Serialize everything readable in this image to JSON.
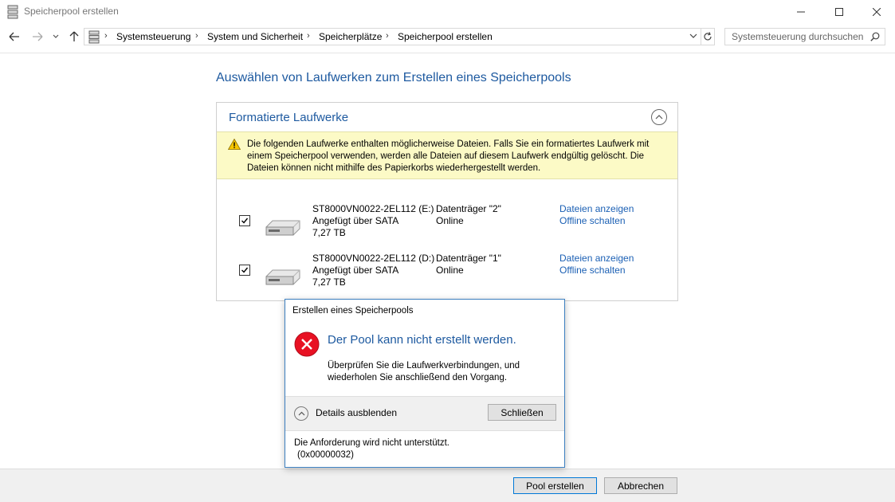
{
  "window": {
    "title": "Speicherpool erstellen"
  },
  "address": {
    "breadcrumbs": [
      "Systemsteuerung",
      "System und Sicherheit",
      "Speicherplätze",
      "Speicherpool erstellen"
    ],
    "search_placeholder": "Systemsteuerung durchsuchen"
  },
  "main": {
    "heading": "Auswählen von Laufwerken zum Erstellen eines Speicherpools",
    "panel_title": "Formatierte Laufwerke",
    "warning": "Die folgenden Laufwerke enthalten möglicherweise Dateien. Falls Sie ein formatiertes Laufwerk mit einem Speicherpool verwenden, werden alle Dateien auf diesem Laufwerk endgültig gelöscht. Die Dateien können nicht mithilfe des Papierkorbs wiederhergestellt werden.",
    "drives": [
      {
        "checked": true,
        "name": "ST8000VN0022-2EL112 (E:)",
        "connection": "Angefügt über SATA",
        "size": "7,27 TB",
        "disk": "Datenträger \"2\"",
        "status": "Online",
        "link_files": "Dateien anzeigen",
        "link_offline": "Offline schalten"
      },
      {
        "checked": true,
        "name": "ST8000VN0022-2EL112 (D:)",
        "connection": "Angefügt über SATA",
        "size": "7,27 TB",
        "disk": "Datenträger \"1\"",
        "status": "Online",
        "link_files": "Dateien anzeigen",
        "link_offline": "Offline schalten"
      }
    ]
  },
  "footer": {
    "create_label": "Pool erstellen",
    "cancel_label": "Abbrechen"
  },
  "dialog": {
    "title": "Erstellen eines Speicherpools",
    "main_instruction": "Der Pool kann nicht erstellt werden.",
    "content": "Überprüfen Sie die Laufwerkverbindungen, und wiederholen Sie anschließend den Vorgang.",
    "details_label": "Details ausblenden",
    "close_label": "Schließen",
    "details_line1": "Die Anforderung wird nicht unterstützt.",
    "details_line2": "(0x00000032)"
  },
  "colors": {
    "heading_blue": "#1e5aa0",
    "link_blue": "#1a5fb4",
    "warning_bg": "#fcfac6",
    "error_red": "#e81123"
  }
}
